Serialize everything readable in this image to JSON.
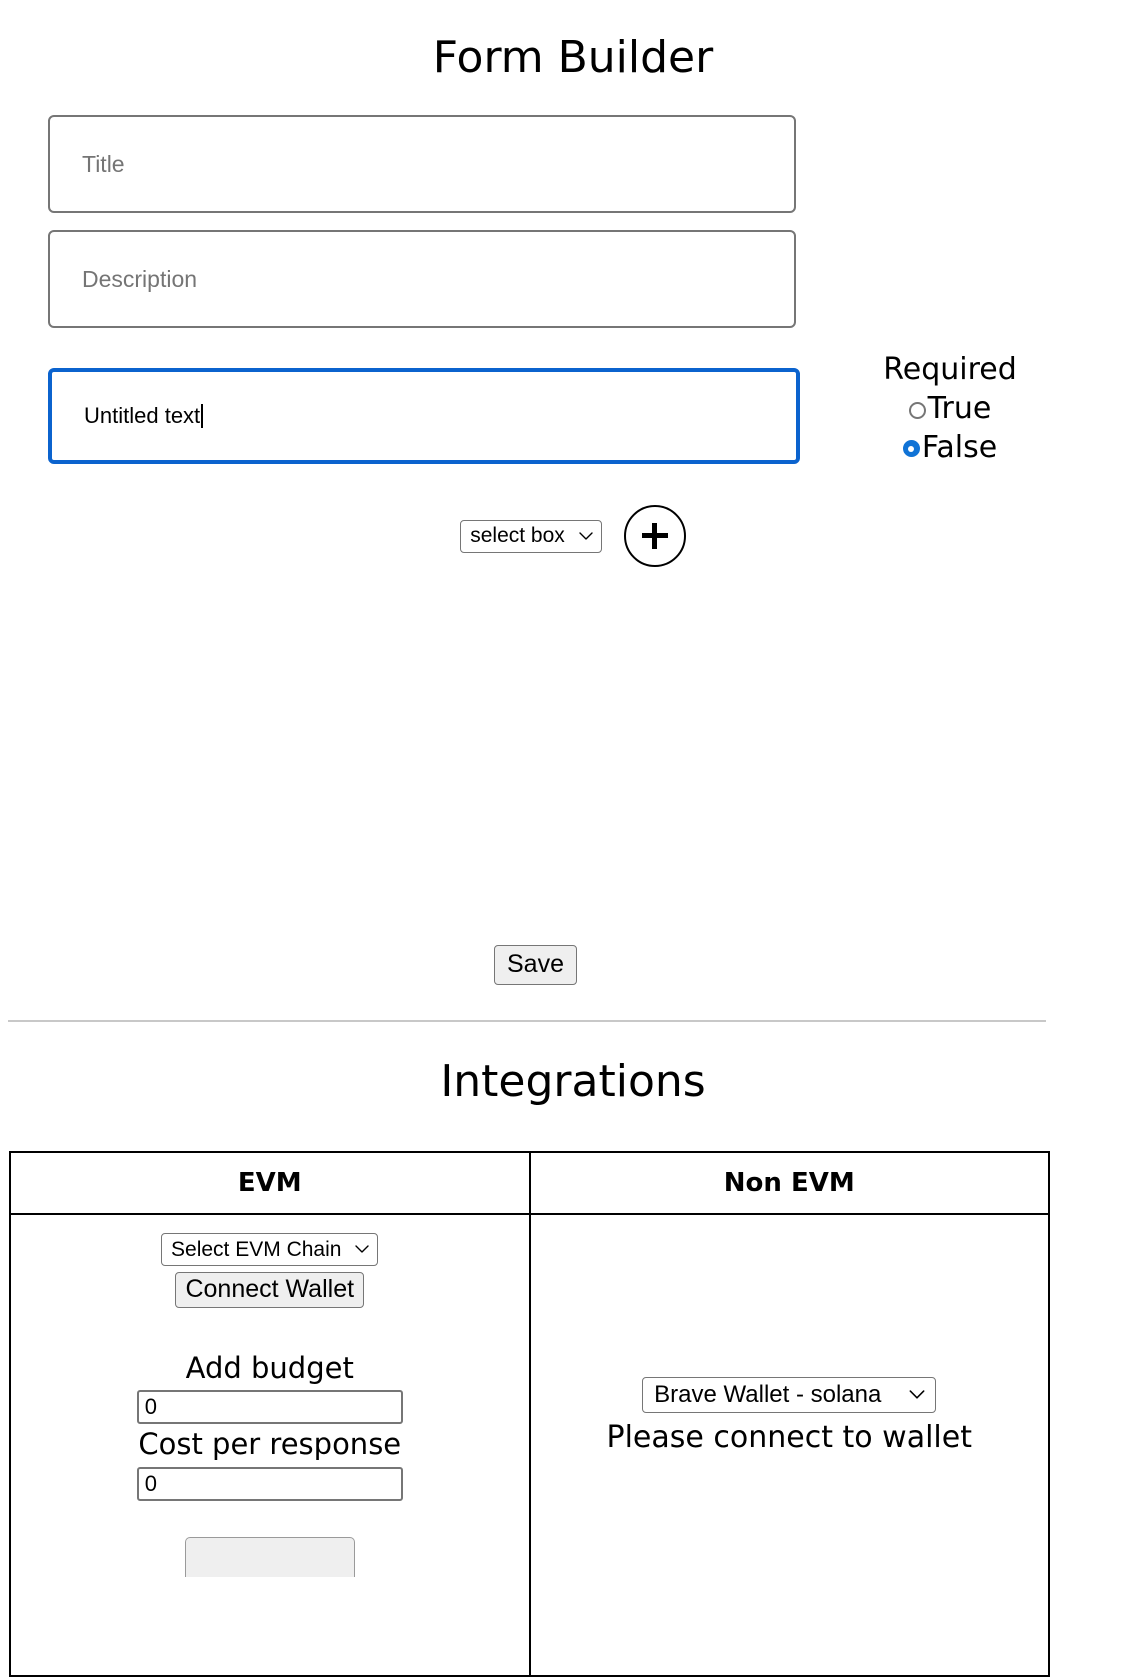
{
  "form_builder": {
    "title": "Form Builder",
    "fields": {
      "title_placeholder": "Title",
      "description_placeholder": "Description",
      "question_value": "Untitled text"
    },
    "required": {
      "label": "Required",
      "options": [
        {
          "label": "True",
          "selected": false
        },
        {
          "label": "False",
          "selected": true
        }
      ]
    },
    "field_type_select": {
      "selected": "select box"
    },
    "add_button_icon": "plus-icon",
    "save_label": "Save"
  },
  "integrations": {
    "title": "Integrations",
    "columns": [
      "EVM",
      "Non EVM"
    ],
    "evm": {
      "chain_select": "Select EVM Chain",
      "connect_wallet_label": "Connect Wallet",
      "add_budget_label": "Add budget",
      "add_budget_value": "0",
      "cost_per_response_label": "Cost per response",
      "cost_per_response_value": "0"
    },
    "non_evm": {
      "wallet_select": "Brave Wallet - solana",
      "status_message": "Please connect to wallet"
    }
  },
  "colors": {
    "focus_border": "#0b63ce",
    "radio_selected": "#1073d6",
    "input_border": "#767676",
    "button_face": "#efefef",
    "divider": "#c8c8c8"
  }
}
